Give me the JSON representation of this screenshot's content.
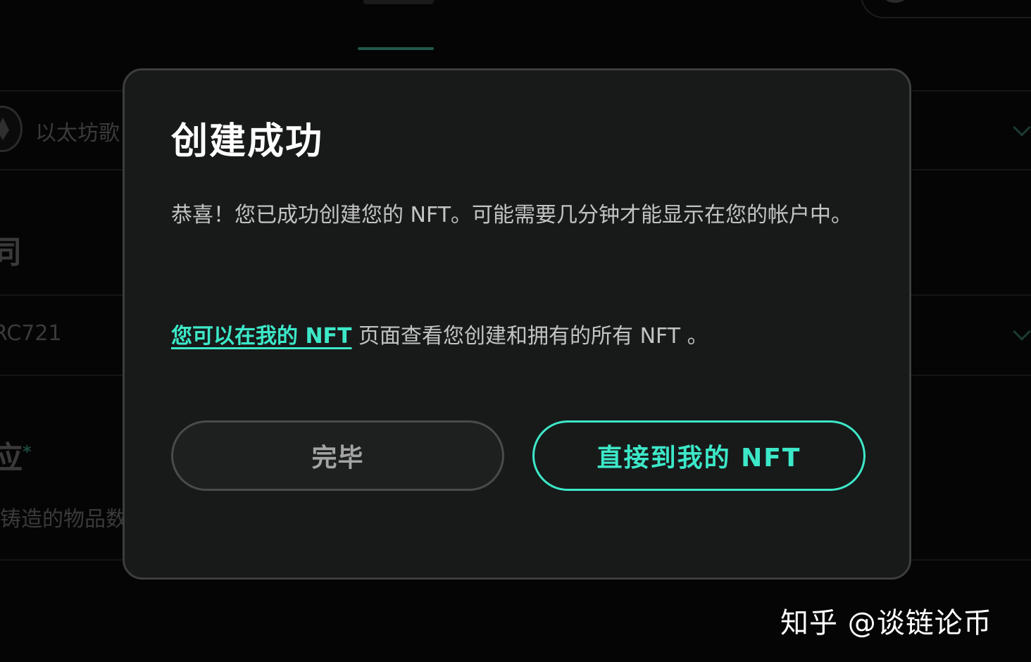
{
  "background": {
    "network_label": "以太坊歌",
    "contract_heading": "同",
    "token_standard": "RC721",
    "supply_heading": "应",
    "supply_required_mark": "*",
    "supply_hint": "铸造的物品数"
  },
  "modal": {
    "title": "创建成功",
    "body_text": "恭喜！您已成功创建您的 NFT。可能需要几分钟才能显示在您的帐户中。",
    "note_link": "您可以在我的 NFT",
    "note_rest": " 页面查看您创建和拥有的所有 NFT 。",
    "done_button": "完毕",
    "go_button": "直接到我的 NFT"
  },
  "watermark": "知乎 @谈链论币",
  "colors": {
    "accent": "#3ce8c8",
    "modal_bg": "#181a1a",
    "page_bg": "#050505"
  }
}
